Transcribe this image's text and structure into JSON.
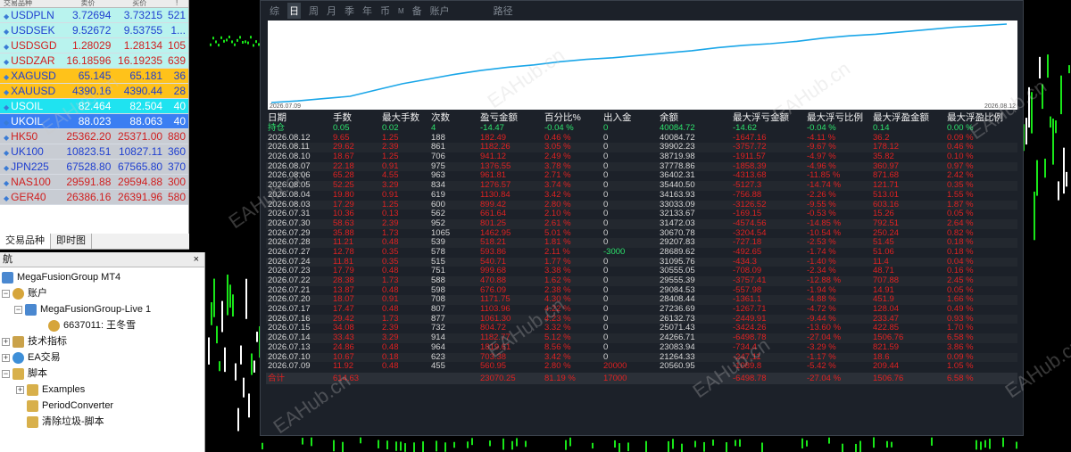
{
  "market_watch": {
    "header": {
      "symbol": "交易品种",
      "bid": "卖价",
      "ask": "买价",
      "spread": "!"
    },
    "rows": [
      {
        "symbol": "USDPLN",
        "bid": "3.72694",
        "ask": "3.73215",
        "spread": "521",
        "bg": "#b9f3ee",
        "color": "#1f3fd0"
      },
      {
        "symbol": "USDSEK",
        "bid": "9.52672",
        "ask": "9.53755",
        "spread": "1...",
        "bg": "#b9f3ee",
        "color": "#1f3fd0"
      },
      {
        "symbol": "USDSGD",
        "bid": "1.28029",
        "ask": "1.28134",
        "spread": "105",
        "bg": "#b9f3ee",
        "color": "#d02020"
      },
      {
        "symbol": "USDZAR",
        "bid": "16.18596",
        "ask": "16.19235",
        "spread": "639",
        "bg": "#b9f3ee",
        "color": "#d02020"
      },
      {
        "symbol": "XAGUSD",
        "bid": "65.145",
        "ask": "65.181",
        "spread": "36",
        "bg": "#ffc21a",
        "color": "#1f3fd0"
      },
      {
        "symbol": "XAUUSD",
        "bid": "4390.16",
        "ask": "4390.44",
        "spread": "28",
        "bg": "#ffc21a",
        "color": "#1f3fd0"
      },
      {
        "symbol": "USOIL",
        "bid": "82.464",
        "ask": "82.504",
        "spread": "40",
        "bg": "#1fe3f0",
        "color": "#ffffff"
      },
      {
        "symbol": "UKOIL",
        "bid": "88.023",
        "ask": "88.063",
        "spread": "40",
        "bg": "#3b7ef2",
        "color": "#ffffff"
      },
      {
        "symbol": "HK50",
        "bid": "25362.20",
        "ask": "25371.00",
        "spread": "880",
        "bg": "#c8ccd3",
        "color": "#d02020"
      },
      {
        "symbol": "UK100",
        "bid": "10823.51",
        "ask": "10827.11",
        "spread": "360",
        "bg": "#c8ccd3",
        "color": "#1f3fd0"
      },
      {
        "symbol": "JPN225",
        "bid": "67528.80",
        "ask": "67565.80",
        "spread": "370",
        "bg": "#c8ccd3",
        "color": "#1f3fd0"
      },
      {
        "symbol": "NAS100",
        "bid": "29591.88",
        "ask": "29594.88",
        "spread": "300",
        "bg": "#c8ccd3",
        "color": "#d02020"
      },
      {
        "symbol": "GER40",
        "bid": "26386.16",
        "ask": "26391.96",
        "spread": "580",
        "bg": "#c8ccd3",
        "color": "#d02020"
      }
    ],
    "tabs": [
      "交易品种",
      "即时图"
    ]
  },
  "navigator": {
    "title": "航",
    "close": "×",
    "items": [
      {
        "label": "MegaFusionGroup MT4",
        "icon": "server"
      },
      {
        "label": "账户",
        "icon": "user"
      },
      {
        "label": "MegaFusionGroup-Live 1",
        "icon": "server"
      },
      {
        "label": "6637011: 王冬雪",
        "icon": "user"
      },
      {
        "label": "技术指标",
        "icon": "ind"
      },
      {
        "label": "EA交易",
        "icon": "ea"
      },
      {
        "label": "脚本",
        "icon": "script"
      },
      {
        "label": "Examples",
        "icon": "script"
      },
      {
        "label": "PeriodConverter",
        "icon": "script"
      },
      {
        "label": "清除垃圾-脚本",
        "icon": "script"
      }
    ]
  },
  "report": {
    "tabs": [
      "综",
      "日",
      "周",
      "月",
      "季",
      "年",
      "币",
      "M",
      "备",
      "账户",
      "路径"
    ],
    "active_tab": "日",
    "chart": {
      "start_label": "2026.07.09",
      "end_label": "2026.08.12",
      "line_color": "#1aa6e8",
      "values": [
        0,
        0.02,
        0.05,
        0.08,
        0.16,
        0.24,
        0.3,
        0.36,
        0.41,
        0.45,
        0.48,
        0.52,
        0.55,
        0.57,
        0.6,
        0.63,
        0.66,
        0.7,
        0.73,
        0.75,
        0.78,
        0.82,
        0.85,
        0.87,
        0.9,
        0.93,
        0.96,
        0.98,
        1.0
      ]
    },
    "headers": [
      "日期",
      "手数",
      "最大手数",
      "次数",
      "盈亏金额",
      "百分比%",
      "出入金",
      "余额",
      "最大浮亏金额",
      "最大浮亏比例",
      "最大浮盈金额",
      "最大浮盈比例"
    ],
    "holding": [
      "持仓",
      "0.05",
      "0.02",
      "4",
      "-14.47",
      "-0.04 %",
      "0",
      "40084.72",
      "-14.62",
      "-0.04 %",
      "0.14",
      "0.00 %"
    ],
    "rows": [
      [
        "2026.08.12",
        "9.65",
        "1.25",
        "188",
        "182.49",
        "0.46 %",
        "0",
        "40084.72",
        "-1647.16",
        "-4.11 %",
        "36.2",
        "0.09 %"
      ],
      [
        "2026.08.11",
        "29.62",
        "2.39",
        "861",
        "1182.26",
        "3.05 %",
        "0",
        "39902.23",
        "-3757.72",
        "-9.67 %",
        "178.12",
        "0.46 %"
      ],
      [
        "2026.08.10",
        "18.67",
        "1.25",
        "706",
        "941.12",
        "2.49 %",
        "0",
        "38719.98",
        "-1911.57",
        "-4.97 %",
        "35.82",
        "0.10 %"
      ],
      [
        "2026.08.07",
        "22.18",
        "0.91",
        "975",
        "1376.55",
        "3.78 %",
        "0",
        "37778.86",
        "-1858.39",
        "-4.96 %",
        "360.97",
        "0.97 %"
      ],
      [
        "2026.08.06",
        "65.28",
        "4.55",
        "963",
        "961.81",
        "2.71 %",
        "0",
        "36402.31",
        "-4313.68",
        "-11.85 %",
        "871.68",
        "2.42 %"
      ],
      [
        "2026.08.05",
        "52.25",
        "3.29",
        "834",
        "1276.57",
        "3.74 %",
        "0",
        "35440.50",
        "-5127.3",
        "-14.74 %",
        "121.71",
        "0.35 %"
      ],
      [
        "2026.08.04",
        "19.80",
        "0.91",
        "619",
        "1130.84",
        "3.42 %",
        "0",
        "34163.93",
        "-756.88",
        "-2.26 %",
        "513.01",
        "1.55 %"
      ],
      [
        "2026.08.03",
        "17.29",
        "1.25",
        "600",
        "899.42",
        "2.80 %",
        "0",
        "33033.09",
        "-3126.52",
        "-9.55 %",
        "603.16",
        "1.87 %"
      ],
      [
        "2026.07.31",
        "10.36",
        "0.13",
        "562",
        "661.64",
        "2.10 %",
        "0",
        "32133.67",
        "-169.15",
        "-0.53 %",
        "15.26",
        "0.05 %"
      ],
      [
        "2026.07.30",
        "58.63",
        "2.39",
        "952",
        "801.25",
        "2.61 %",
        "0",
        "31472.03",
        "-4574.56",
        "-14.85 %",
        "792.51",
        "2.64 %"
      ],
      [
        "2026.07.29",
        "35.88",
        "1.73",
        "1065",
        "1462.95",
        "5.01 %",
        "0",
        "30670.78",
        "-3204.54",
        "-10.54 %",
        "250.24",
        "0.82 %"
      ],
      [
        "2026.07.28",
        "11.21",
        "0.48",
        "539",
        "518.21",
        "1.81 %",
        "0",
        "29207.83",
        "-727.18",
        "-2.53 %",
        "51.45",
        "0.18 %"
      ],
      [
        "2026.07.27",
        "12.78",
        "0.35",
        "578",
        "593.86",
        "2.11 %",
        "-3000",
        "28689.62",
        "-492.65",
        "-1.74 %",
        "51.06",
        "0.18 %"
      ],
      [
        "2026.07.24",
        "11.81",
        "0.35",
        "515",
        "540.71",
        "1.77 %",
        "0",
        "31095.76",
        "-434.3",
        "-1.40 %",
        "11.4",
        "0.04 %"
      ],
      [
        "2026.07.23",
        "17.79",
        "0.48",
        "751",
        "999.68",
        "3.38 %",
        "0",
        "30555.05",
        "-708.09",
        "-2.34 %",
        "48.71",
        "0.16 %"
      ],
      [
        "2026.07.22",
        "28.38",
        "1.73",
        "588",
        "470.88",
        "1.62 %",
        "0",
        "29555.39",
        "-3757.41",
        "-12.88 %",
        "707.88",
        "2.45 %"
      ],
      [
        "2026.07.21",
        "13.87",
        "0.48",
        "598",
        "676.09",
        "2.38 %",
        "0",
        "29084.53",
        "-557.98",
        "-1.94 %",
        "14.91",
        "0.05 %"
      ],
      [
        "2026.07.20",
        "18.07",
        "0.91",
        "708",
        "1171.75",
        "4.30 %",
        "0",
        "28408.44",
        "-1361.1",
        "-4.88 %",
        "451.9",
        "1.66 %"
      ],
      [
        "2026.07.17",
        "17.47",
        "0.48",
        "807",
        "1103.96",
        "4.22 %",
        "0",
        "27236.69",
        "-1267.71",
        "-4.72 %",
        "128.04",
        "0.49 %"
      ],
      [
        "2026.07.16",
        "29.42",
        "1.73",
        "877",
        "1061.30",
        "4.23 %",
        "0",
        "26132.73",
        "-2449.91",
        "-9.44 %",
        "233.47",
        "0.93 %"
      ],
      [
        "2026.07.15",
        "34.08",
        "2.39",
        "732",
        "804.72",
        "3.32 %",
        "0",
        "25071.43",
        "-3424.26",
        "-13.60 %",
        "422.85",
        "1.70 %"
      ],
      [
        "2026.07.14",
        "33.43",
        "3.29",
        "914",
        "1182.77",
        "5.12 %",
        "0",
        "24266.71",
        "-6498.78",
        "-27.04 %",
        "1506.76",
        "6.58 %"
      ],
      [
        "2026.07.13",
        "24.86",
        "0.48",
        "964",
        "1819.61",
        "8.56 %",
        "0",
        "23083.94",
        "-734.4",
        "-3.29 %",
        "821.59",
        "3.86 %"
      ],
      [
        "2026.07.10",
        "10.67",
        "0.18",
        "623",
        "703.38",
        "3.42 %",
        "0",
        "21264.33",
        "-247.11",
        "-1.17 %",
        "18.6",
        "0.09 %"
      ],
      [
        "2026.07.09",
        "11.92",
        "0.48",
        "455",
        "560.95",
        "2.80 %",
        "20000",
        "20560.95",
        "-1089.8",
        "-5.42 %",
        "209.44",
        "1.05 %"
      ]
    ],
    "total": [
      "合计",
      "614.63",
      "",
      "",
      "23070.25",
      "81.19 %",
      "17000",
      "",
      "-6498.78",
      "-27.04 %",
      "1506.76",
      "6.58 %"
    ]
  },
  "watermarks": [
    "EAHub.cn"
  ]
}
